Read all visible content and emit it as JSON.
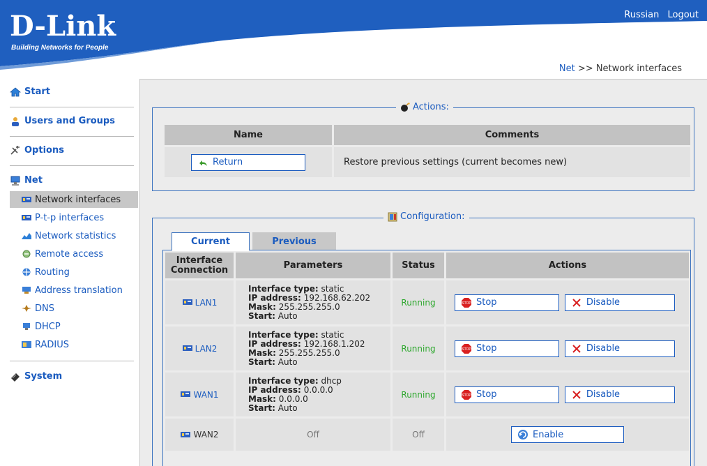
{
  "header": {
    "logo": "D-Link",
    "tagline": "Building Networks for People",
    "links": [
      "Russian",
      "Logout"
    ]
  },
  "breadcrumb": {
    "parent": "Net",
    "separator": ">>",
    "current": "Network interfaces"
  },
  "sidebar": {
    "sections": [
      {
        "label": "Start",
        "icon": "home-icon"
      },
      {
        "label": "Users and Groups",
        "icon": "users-icon"
      },
      {
        "label": "Options",
        "icon": "options-icon"
      },
      {
        "label": "Net",
        "icon": "net-icon"
      },
      {
        "label": "System",
        "icon": "system-icon"
      }
    ],
    "net_items": [
      {
        "label": "Network interfaces",
        "icon": "network-card-icon",
        "active": true
      },
      {
        "label": "P-t-p interfaces",
        "icon": "network-card-icon"
      },
      {
        "label": "Network statistics",
        "icon": "statistics-icon"
      },
      {
        "label": "Remote access",
        "icon": "remote-access-icon"
      },
      {
        "label": "Routing",
        "icon": "routing-icon"
      },
      {
        "label": "Address translation",
        "icon": "address-translation-icon"
      },
      {
        "label": "DNS",
        "icon": "dns-icon"
      },
      {
        "label": "DHCP",
        "icon": "dhcp-icon"
      },
      {
        "label": "RADIUS",
        "icon": "radius-icon"
      }
    ]
  },
  "actions": {
    "legend": "Actions:",
    "headers": [
      "Name",
      "Comments"
    ],
    "return_label": "Return",
    "return_comment": "Restore previous settings (current becomes new)"
  },
  "configuration": {
    "legend": "Configuration:",
    "tabs": [
      "Current",
      "Previous"
    ],
    "headers": [
      "Interface Connection",
      "Parameters",
      "Status",
      "Actions"
    ],
    "param_labels": {
      "type": "Interface type:",
      "ip": "IP address:",
      "mask": "Mask:",
      "start": "Start:"
    },
    "rows": [
      {
        "name": "LAN1",
        "type": "static",
        "ip": "192.168.62.202",
        "mask": "255.255.255.0",
        "start": "Auto",
        "status": "Running",
        "stop": "Stop",
        "disable": "Disable"
      },
      {
        "name": "LAN2",
        "type": "static",
        "ip": "192.168.1.202",
        "mask": "255.255.255.0",
        "start": "Auto",
        "status": "Running",
        "stop": "Stop",
        "disable": "Disable"
      },
      {
        "name": "WAN1",
        "type": "dhcp",
        "ip": "0.0.0.0",
        "mask": "0.0.0.0",
        "start": "Auto",
        "status": "Running",
        "stop": "Stop",
        "disable": "Disable"
      },
      {
        "name": "WAN2",
        "params": "Off",
        "status": "Off",
        "enable": "Enable"
      }
    ]
  },
  "colors": {
    "header_blue": "#1f5fbf",
    "link_blue": "#1a5bbf",
    "running_green": "#2fa82f",
    "stop_red": "#d92020"
  }
}
